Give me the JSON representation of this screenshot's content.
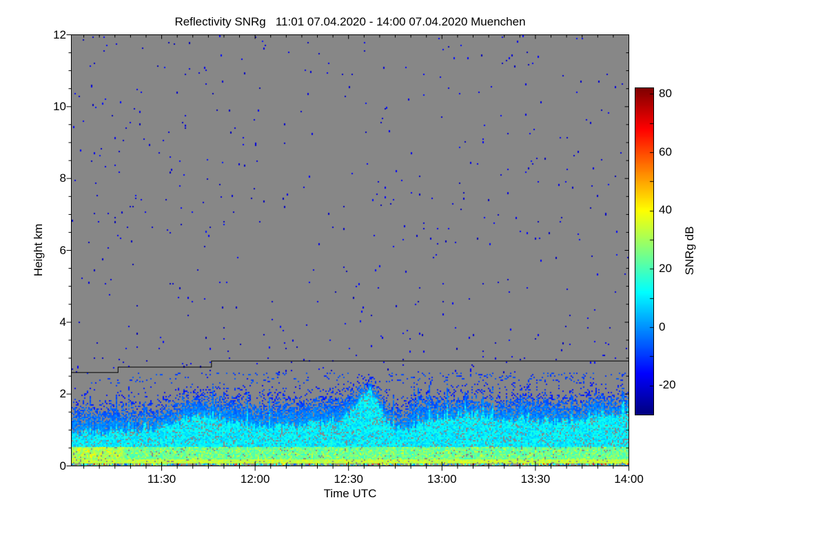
{
  "figure": {
    "background_color": "#ffffff",
    "frame_color": "#000000"
  },
  "chart_data": {
    "type": "heatmap",
    "title": "Reflectivity SNRg   11:01 07.04.2020 - 14:00 07.04.2020 Muenchen",
    "quantity": "Reflectivity SNRg",
    "period_start": "11:01 07.04.2020",
    "period_end": "14:00 07.04.2020",
    "station": "Muenchen",
    "xlabel": "Time UTC",
    "ylabel": "Height km",
    "x_range_minutes": [
      661,
      840
    ],
    "x_major_ticks": [
      {
        "minute": 690,
        "label": "11:30"
      },
      {
        "minute": 720,
        "label": "12:00"
      },
      {
        "minute": 750,
        "label": "12:30"
      },
      {
        "minute": 780,
        "label": "13:00"
      },
      {
        "minute": 810,
        "label": "13:30"
      },
      {
        "minute": 840,
        "label": "14:00"
      }
    ],
    "x_minor_step_minutes": 5,
    "ylim": [
      0,
      12
    ],
    "y_major_ticks": [
      {
        "value": 0,
        "label": "0"
      },
      {
        "value": 2,
        "label": "2"
      },
      {
        "value": 4,
        "label": "4"
      },
      {
        "value": 6,
        "label": "6"
      },
      {
        "value": 8,
        "label": "8"
      },
      {
        "value": 10,
        "label": "10"
      },
      {
        "value": 12,
        "label": "12"
      }
    ],
    "y_minor_step": 0.5,
    "colorbar": {
      "label": "SNRg dB",
      "vmin": -30,
      "vmax": 82,
      "colormap": "jet",
      "tick_values": [
        80,
        60,
        40,
        20,
        0,
        -20
      ],
      "minor_tick_step": 10
    },
    "nodata_color": "#878787",
    "cloud_base_line": {
      "color": "#000000",
      "points_min_km": [
        [
          661,
          2.6
        ],
        [
          676,
          2.6
        ],
        [
          676,
          2.75
        ],
        [
          706,
          2.75
        ],
        [
          706,
          2.92
        ],
        [
          840,
          2.92
        ]
      ]
    },
    "boundary_layer_top_km": [
      [
        661,
        1.6
      ],
      [
        666,
        1.72
      ],
      [
        670,
        1.58
      ],
      [
        675,
        1.7
      ],
      [
        680,
        1.62
      ],
      [
        686,
        1.55
      ],
      [
        690,
        1.6
      ],
      [
        695,
        1.78
      ],
      [
        700,
        1.9
      ],
      [
        706,
        1.95
      ],
      [
        712,
        1.92
      ],
      [
        718,
        1.8
      ],
      [
        724,
        1.72
      ],
      [
        730,
        1.8
      ],
      [
        736,
        1.78
      ],
      [
        742,
        1.85
      ],
      [
        748,
        1.95
      ],
      [
        753,
        2.1
      ],
      [
        757,
        2.32
      ],
      [
        760,
        2.1
      ],
      [
        764,
        1.55
      ],
      [
        768,
        1.62
      ],
      [
        772,
        1.85
      ],
      [
        776,
        1.95
      ],
      [
        781,
        1.85
      ],
      [
        786,
        1.92
      ],
      [
        792,
        1.95
      ],
      [
        797,
        1.78
      ],
      [
        802,
        1.85
      ],
      [
        807,
        1.95
      ],
      [
        812,
        1.78
      ],
      [
        817,
        1.85
      ],
      [
        822,
        1.75
      ],
      [
        827,
        1.9
      ],
      [
        832,
        1.98
      ],
      [
        836,
        1.85
      ],
      [
        840,
        1.92
      ]
    ],
    "core_top_fraction": [
      [
        661,
        0.55
      ],
      [
        680,
        0.6
      ],
      [
        700,
        0.72
      ],
      [
        715,
        0.65
      ],
      [
        730,
        0.62
      ],
      [
        748,
        0.68
      ],
      [
        757,
        0.93
      ],
      [
        763,
        0.7
      ],
      [
        770,
        0.6
      ],
      [
        780,
        0.7
      ],
      [
        790,
        0.75
      ],
      [
        800,
        0.7
      ],
      [
        810,
        0.65
      ],
      [
        820,
        0.68
      ],
      [
        830,
        0.72
      ],
      [
        840,
        0.78
      ]
    ],
    "surface_band": {
      "top_km": 0.18,
      "value_db_range": [
        29,
        38
      ]
    },
    "detached_speckle_band_km": [
      2.3,
      2.58
    ],
    "cyan_streaks": [
      {
        "m": 669,
        "len_min": 4,
        "h_km": 0.77
      },
      {
        "m": 699,
        "len_min": 5,
        "h_km": 0.98
      },
      {
        "m": 707,
        "len_min": 4,
        "h_km": 0.98
      },
      {
        "m": 736,
        "len_min": 4,
        "h_km": 1.02
      },
      {
        "m": 758,
        "len_min": 5,
        "h_km": 1.05
      },
      {
        "m": 770,
        "len_min": 4,
        "h_km": 1.04
      },
      {
        "m": 800,
        "len_min": 3,
        "h_km": 1.08
      },
      {
        "m": 816,
        "len_min": 4,
        "h_km": 1.1
      }
    ],
    "noise": {
      "seed": 7,
      "upper_speckle_prob": 0.0045,
      "midlevel_speckle_prob": 0.012
    }
  }
}
